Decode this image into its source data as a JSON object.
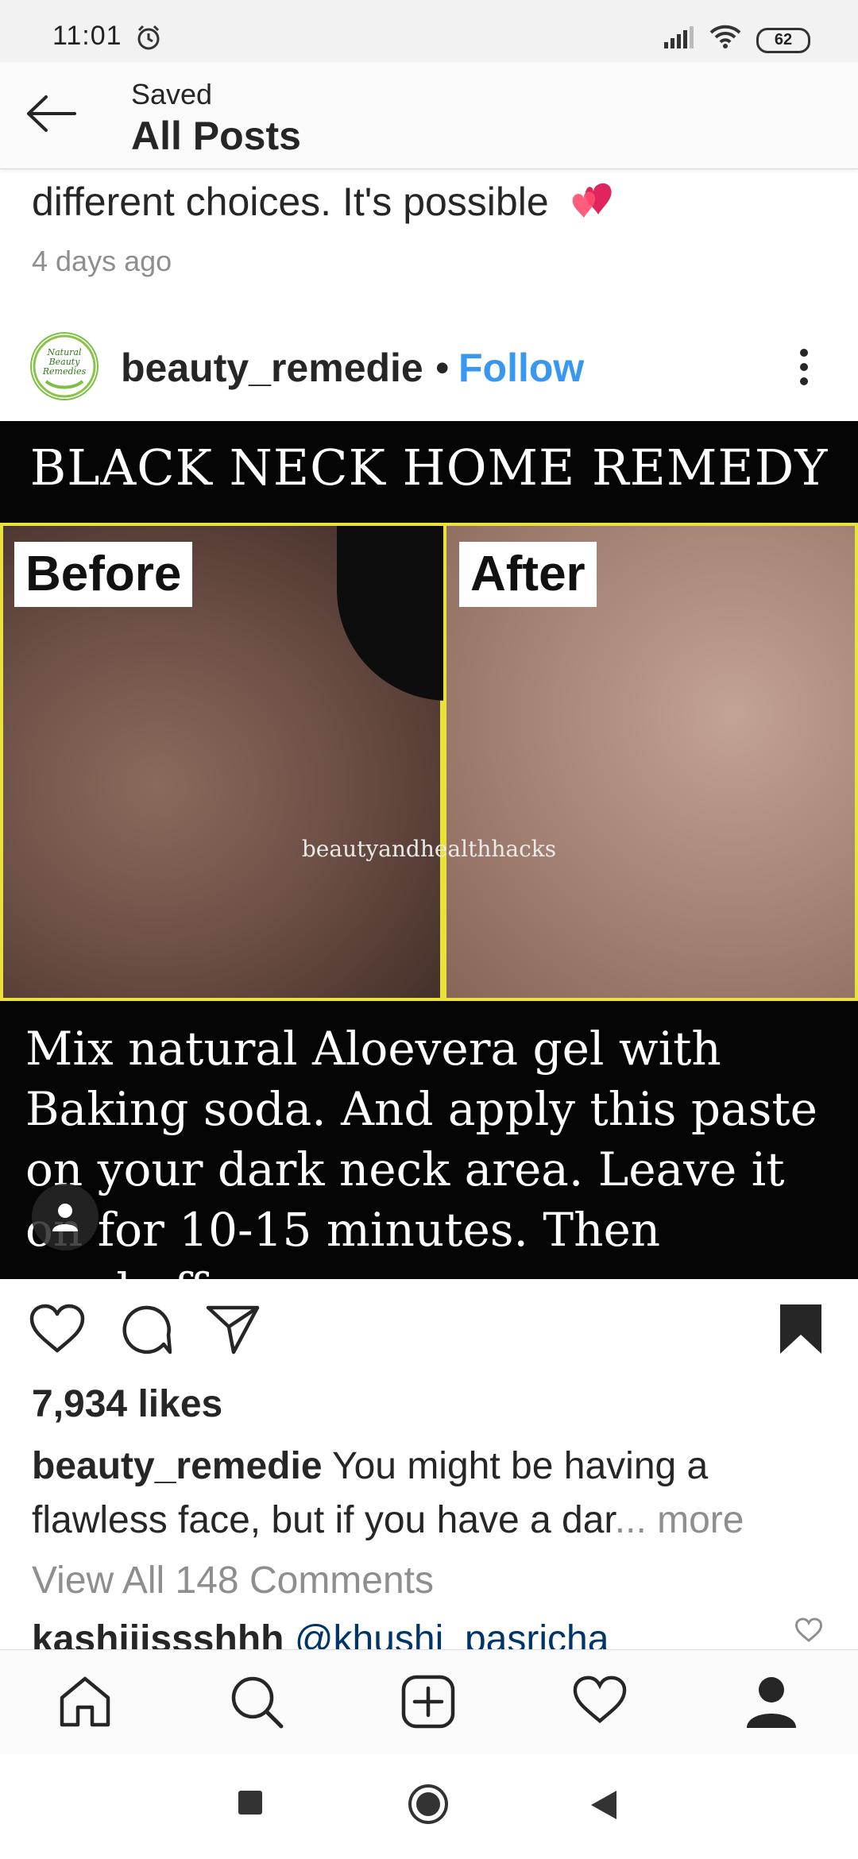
{
  "status_bar": {
    "time": "11:01",
    "battery": "62",
    "icons": [
      "alarm-icon",
      "signal-icon",
      "wifi-icon",
      "battery-icon"
    ]
  },
  "header": {
    "subtitle": "Saved",
    "title": "All Posts"
  },
  "previous_post": {
    "caption": "different choices. It's possible",
    "time": "4 days ago"
  },
  "post": {
    "username": "beauty_remedie",
    "separator": "•",
    "follow_label": "Follow",
    "avatar_text": "Natural Beauty Remedies",
    "image": {
      "title": "BLACK NECK HOME REMEDY",
      "before_label": "Before",
      "after_label": "After",
      "watermark": "beautyandhealthhacks",
      "body": "Mix natural Aloevera gel with Baking soda. And apply this paste on your dark neck area. Leave it on for 10-15 minutes. Then washoff"
    },
    "likes": "7,934 likes",
    "caption_user": "beauty_remedie",
    "caption_text": " You might be having a flawless face, but if you have a dar",
    "caption_more": "... more",
    "view_all": "View All 148 Comments",
    "comment_user": "kashiiissshhh",
    "comment_mention": "@khushi_pasricha"
  },
  "colors": {
    "accent_blue": "#3897f0",
    "muted_text": "#8e8e8e",
    "text": "#262626"
  },
  "bottom_nav": [
    "home-icon",
    "search-icon",
    "add-post-icon",
    "activity-heart-icon",
    "profile-icon"
  ],
  "system_nav": [
    "recents-button",
    "home-button",
    "back-button"
  ]
}
